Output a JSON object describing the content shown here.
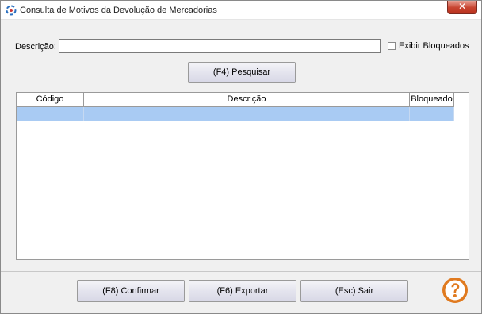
{
  "window": {
    "title": "Consulta de Motivos da Devolução de Mercadorias",
    "close_label": "✕"
  },
  "filter": {
    "description_label": "Descrição:",
    "description_value": "",
    "show_blocked_label": "Exibir Bloqueados",
    "show_blocked_checked": false,
    "search_button": "(F4) Pesquisar"
  },
  "grid": {
    "columns": [
      "Código",
      "Descrição",
      "Bloqueado"
    ],
    "rows": [
      [
        "",
        "",
        ""
      ]
    ],
    "selected_row_color": "#a9cbf3"
  },
  "footer": {
    "confirm_button": "(F8) Confirmar",
    "export_button": "(F6) Exportar",
    "exit_button": "(Esc) Sair",
    "help_icon": "help-question-icon",
    "help_color": "#e07a1f"
  }
}
